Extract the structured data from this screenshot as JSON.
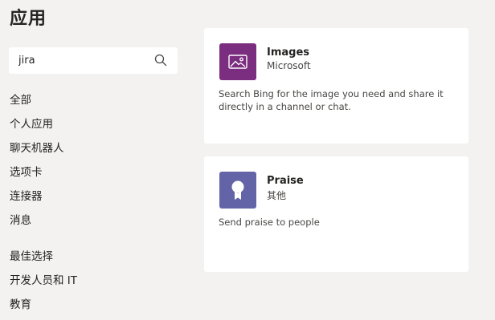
{
  "page": {
    "title": "应用"
  },
  "search": {
    "value": "jira",
    "icon": "search-icon"
  },
  "categories": [
    {
      "label": "全部"
    },
    {
      "label": "个人应用"
    },
    {
      "label": "聊天机器人"
    },
    {
      "label": "选项卡"
    },
    {
      "label": "连接器"
    },
    {
      "label": "消息"
    },
    {
      "label": "最佳选择"
    },
    {
      "label": "开发人员和 IT"
    },
    {
      "label": "教育"
    }
  ],
  "results": [
    {
      "name": "Images",
      "publisher": "Microsoft",
      "description": "Search Bing for the image you need and share it directly in a channel or chat.",
      "icon": "image-icon",
      "tile_color": "#7b2d7f"
    },
    {
      "name": "Praise",
      "publisher": "其他",
      "description": "Send praise to people",
      "icon": "praise-badge-icon",
      "tile_color": "#6264a7"
    }
  ],
  "colors": {
    "page_background": "#f3f2f1",
    "card_background": "#ffffff",
    "text_primary": "#252423",
    "text_secondary": "#484644"
  }
}
